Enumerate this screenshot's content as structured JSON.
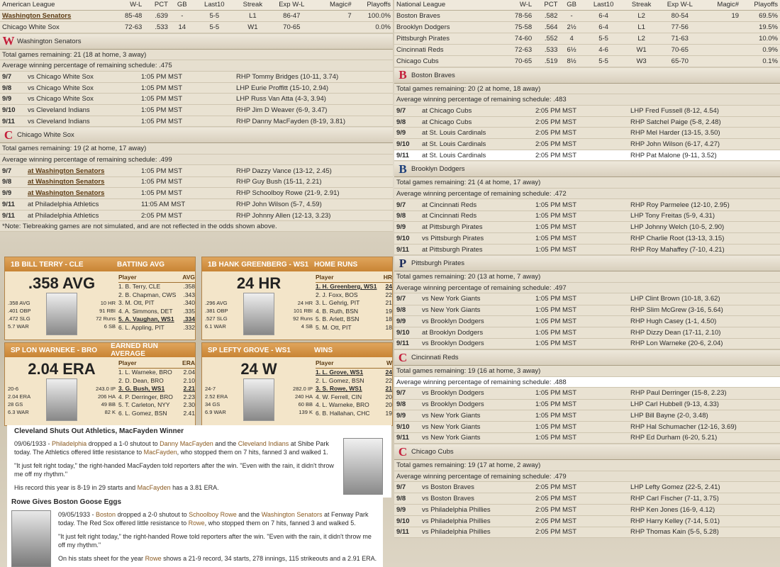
{
  "al": {
    "headers": [
      "American League",
      "W-L",
      "PCT",
      "GB",
      "Last10",
      "Streak",
      "Exp W-L",
      "Magic#",
      "Playoffs"
    ],
    "rows": [
      [
        "Washington Senators",
        "85-48",
        ".639",
        "-",
        "5-5",
        "L1",
        "86-47",
        "7",
        "100.0%"
      ],
      [
        "Chicago White Sox",
        "72-63",
        ".533",
        "14",
        "5-5",
        "W1",
        "70-65",
        "",
        "0.0%"
      ]
    ],
    "teams": [
      {
        "name": "Washington Senators",
        "logo": "W",
        "color": "#c41e3a",
        "rem": "Total games remaining: 21 (18 at home, 3 away)",
        "avg": "Average winning percentage of remaining schedule: .475",
        "games": [
          [
            "9/7",
            "vs Chicago White Sox",
            "1:05 PM MST",
            "RHP Tommy Bridges (10-11, 3.74)"
          ],
          [
            "9/8",
            "vs Chicago White Sox",
            "1:05 PM MST",
            "LHP Eurie Proffitt (15-10, 2.94)"
          ],
          [
            "9/9",
            "vs Chicago White Sox",
            "1:05 PM MST",
            "LHP Russ Van Atta (4-3, 3.94)"
          ],
          [
            "9/10",
            "vs Cleveland Indians",
            "1:05 PM MST",
            "RHP Jim D Weaver (6-9, 3.47)"
          ],
          [
            "9/11",
            "vs Cleveland Indians",
            "1:05 PM MST",
            "RHP Danny MacFayden (8-19, 3.81)"
          ]
        ]
      },
      {
        "name": "Chicago White Sox",
        "logo": "C",
        "color": "#c41e3a",
        "rem": "Total games remaining: 19 (2 at home, 17 away)",
        "avg": "Average winning percentage of remaining schedule: .499",
        "games": [
          [
            "9/7",
            "at Washington Senators",
            "1:05 PM MST",
            "RHP Dazzy Vance (13-12, 2.45)"
          ],
          [
            "9/8",
            "at Washington Senators",
            "1:05 PM MST",
            "RHP Guy Bush (15-11, 2.21)"
          ],
          [
            "9/9",
            "at Washington Senators",
            "1:05 PM MST",
            "RHP Schoolboy Rowe (21-9, 2.91)"
          ],
          [
            "9/11",
            "at Philadelphia Athletics",
            "11:05 AM MST",
            "RHP John Wilson (5-7, 4.59)"
          ],
          [
            "9/11",
            "at Philadelphia Athletics",
            "2:05 PM MST",
            "RHP Johnny Allen (12-13, 3.23)"
          ]
        ]
      }
    ],
    "note": "*Note: Tiebreaking games are not simulated, and are not reflected in the odds shown above."
  },
  "nl": {
    "headers": [
      "National League",
      "W-L",
      "PCT",
      "GB",
      "Last10",
      "Streak",
      "Exp W-L",
      "Magic#",
      "Playoffs"
    ],
    "rows": [
      [
        "Boston Braves",
        "78-56",
        ".582",
        "-",
        "6-4",
        "L2",
        "80-54",
        "19",
        "69.5%"
      ],
      [
        "Brooklyn Dodgers",
        "75-58",
        ".564",
        "2½",
        "6-4",
        "L1",
        "77-56",
        "",
        "19.5%"
      ],
      [
        "Pittsburgh Pirates",
        "74-60",
        ".552",
        "4",
        "5-5",
        "L2",
        "71-63",
        "",
        "10.0%"
      ],
      [
        "Cincinnati Reds",
        "72-63",
        ".533",
        "6½",
        "4-6",
        "W1",
        "70-65",
        "",
        "0.9%"
      ],
      [
        "Chicago Cubs",
        "70-65",
        ".519",
        "8½",
        "5-5",
        "W3",
        "65-70",
        "",
        "0.1%"
      ]
    ],
    "teams": [
      {
        "name": "Boston Braves",
        "logo": "B",
        "color": "#c41e3a",
        "rem": "Total games remaining: 20 (2 at home, 18 away)",
        "avg": "Average winning percentage of remaining schedule: .483",
        "games": [
          [
            "9/7",
            "at Chicago Cubs",
            "2:05 PM MST",
            "LHP Fred Fussell (8-12, 4.54)"
          ],
          [
            "9/8",
            "at Chicago Cubs",
            "2:05 PM MST",
            "RHP Satchel Paige (5-8, 2.48)"
          ],
          [
            "9/9",
            "at St. Louis Cardinals",
            "2:05 PM MST",
            "RHP Mel Harder (13-15, 3.50)"
          ],
          [
            "9/10",
            "at St. Louis Cardinals",
            "2:05 PM MST",
            "RHP John Wilson (6-17, 4.27)"
          ],
          [
            "9/11",
            "at St. Louis Cardinals",
            "2:05 PM MST",
            "RHP Pat Malone (9-11, 3.52)"
          ]
        ]
      },
      {
        "name": "Brooklyn Dodgers",
        "logo": "B",
        "color": "#1d3f7a",
        "rem": "Total games remaining: 21 (4 at home, 17 away)",
        "avg": "Average winning percentage of remaining schedule: .472",
        "games": [
          [
            "9/7",
            "at Cincinnati Reds",
            "1:05 PM MST",
            "RHP Roy Parmelee (12-10, 2.95)"
          ],
          [
            "9/8",
            "at Cincinnati Reds",
            "1:05 PM MST",
            "LHP Tony Freitas (5-9, 4.31)"
          ],
          [
            "9/9",
            "at Pittsburgh Pirates",
            "1:05 PM MST",
            "LHP Johnny Welch (10-5, 2.90)"
          ],
          [
            "9/10",
            "vs Pittsburgh Pirates",
            "1:05 PM MST",
            "RHP Charlie Root (13-13, 3.15)"
          ],
          [
            "9/11",
            "at Pittsburgh Pirates",
            "1:05 PM MST",
            "RHP Roy Mahaffey (7-10, 4.21)"
          ]
        ]
      },
      {
        "name": "Pittsburgh Pirates",
        "logo": "P",
        "color": "#1a2a5a",
        "rem": "Total games remaining: 20 (13 at home, 7 away)",
        "avg": "Average winning percentage of remaining schedule: .497",
        "games": [
          [
            "9/7",
            "vs New York Giants",
            "1:05 PM MST",
            "LHP Clint Brown (10-18, 3.62)"
          ],
          [
            "9/8",
            "vs New York Giants",
            "1:05 PM MST",
            "RHP Slim McGrew (3-16, 5.64)"
          ],
          [
            "9/9",
            "vs Brooklyn Dodgers",
            "1:05 PM MST",
            "RHP Hugh Casey (1-1, 4.50)"
          ],
          [
            "9/10",
            "at Brooklyn Dodgers",
            "1:05 PM MST",
            "RHP Dizzy Dean (17-11, 2.10)"
          ],
          [
            "9/11",
            "vs Brooklyn Dodgers",
            "1:05 PM MST",
            "RHP Lon Warneke (20-6, 2.04)"
          ]
        ]
      },
      {
        "name": "Cincinnati Reds",
        "logo": "C",
        "color": "#c41e3a",
        "rem": "Total games remaining: 19 (16 at home, 3 away)",
        "avg": "Average winning percentage of remaining schedule: .488",
        "games": [
          [
            "9/7",
            "vs Brooklyn Dodgers",
            "1:05 PM MST",
            "RHP Paul Derringer (15-8, 2.23)"
          ],
          [
            "9/8",
            "vs Brooklyn Dodgers",
            "1:05 PM MST",
            "LHP Carl Hubbell (9-13, 4.33)"
          ],
          [
            "9/9",
            "vs New York Giants",
            "1:05 PM MST",
            "LHP Bill Bayne (2-0, 3.48)"
          ],
          [
            "9/10",
            "vs New York Giants",
            "1:05 PM MST",
            "RHP Hal Schumacher (12-16, 3.69)"
          ],
          [
            "9/11",
            "vs New York Giants",
            "1:05 PM MST",
            "RHP Ed Durham (6-20, 5.21)"
          ]
        ]
      },
      {
        "name": "Chicago Cubs",
        "logo": "C",
        "color": "#c41e3a",
        "rem": "Total games remaining: 19 (17 at home, 2 away)",
        "avg": "Average winning percentage of remaining schedule: .479",
        "games": [
          [
            "9/7",
            "vs Boston Braves",
            "2:05 PM MST",
            "LHP Lefty Gomez (22-5, 2.41)"
          ],
          [
            "9/8",
            "vs Boston Braves",
            "2:05 PM MST",
            "RHP Carl Fischer (7-11, 3.75)"
          ],
          [
            "9/9",
            "vs Philadelphia Phillies",
            "2:05 PM MST",
            "RHP Ken Jones (16-9, 4.12)"
          ],
          [
            "9/10",
            "vs Philadelphia Phillies",
            "2:05 PM MST",
            "RHP Harry Kelley (7-14, 5.01)"
          ],
          [
            "9/11",
            "vs Philadelphia Phillies",
            "2:05 PM MST",
            "RHP Thomas Kain (5-5, 5.28)"
          ]
        ]
      }
    ]
  },
  "leaders": [
    {
      "title": "1B BILL TERRY - CLE",
      "stat": "BATTING AVG",
      "big": ".358 AVG",
      "left": [
        ".358 AVG",
        ".401 OBP",
        ".472 SLG",
        "5.7 WAR"
      ],
      "right": [
        "10 HR",
        "91 RBI",
        "72 Runs",
        "6 SB"
      ],
      "colname": "AVG",
      "rows": [
        [
          "1. B. Terry, CLE",
          ".358"
        ],
        [
          "2. B. Chapman, CWS",
          ".343"
        ],
        [
          "3. M. Ott, PIT",
          ".340"
        ],
        [
          "4. A. Simmons, DET",
          ".335"
        ],
        [
          "5. A. Vaughan, WS1",
          ".334"
        ],
        [
          "6. L. Appling, PIT",
          ".332"
        ]
      ],
      "sel": 4
    },
    {
      "title": "1B HANK GREENBERG - WS1",
      "stat": "HOME RUNS",
      "big": "24 HR",
      "left": [
        ".296 AVG",
        ".381 OBP",
        ".527 SLG",
        "6.1 WAR"
      ],
      "right": [
        "24 HR",
        "101 RBI",
        "92 Runs",
        "4 SB"
      ],
      "colname": "HR",
      "rows": [
        [
          "1. H. Greenberg, WS1",
          "24"
        ],
        [
          "2. J. Foxx, BOS",
          "22"
        ],
        [
          "3. L. Gehrig, PIT",
          "21"
        ],
        [
          "4. B. Ruth, BSN",
          "19"
        ],
        [
          "5. B. Arlett, BSN",
          "18"
        ],
        [
          "5. M. Ott, PIT",
          "18"
        ]
      ],
      "sel": 0
    },
    {
      "title": "SP LON WARNEKE - BRO",
      "stat": "EARNED RUN AVERAGE",
      "big": "2.04 ERA",
      "left": [
        "20-6",
        "2.04 ERA",
        "28 GS",
        "6.3 WAR"
      ],
      "right": [
        "243.0 IP",
        "206 HA",
        "49 BB",
        "82 K"
      ],
      "colname": "ERA",
      "rows": [
        [
          "1. L. Warneke, BRO",
          "2.04"
        ],
        [
          "2. D. Dean, BRO",
          "2.10"
        ],
        [
          "3. G. Bush, WS1",
          "2.21"
        ],
        [
          "4. P. Derringer, BRO",
          "2.23"
        ],
        [
          "5. T. Carleton, NYY",
          "2.30"
        ],
        [
          "6. L. Gomez, BSN",
          "2.41"
        ]
      ],
      "sel": 2
    },
    {
      "title": "SP LEFTY GROVE - WS1",
      "stat": "WINS",
      "big": "24 W",
      "left": [
        "24-7",
        "2.52 ERA",
        "34 GS",
        "6.9 WAR"
      ],
      "right": [
        "282.0 IP",
        "240 HA",
        "60 BB",
        "139 K"
      ],
      "colname": "W",
      "rows": [
        [
          "1. L. Grove, WS1",
          "24"
        ],
        [
          "2. L. Gomez, BSN",
          "22"
        ],
        [
          "3. S. Rowe, WS1",
          "21"
        ],
        [
          "4. W. Ferrell, CIN",
          "20"
        ],
        [
          "4. L. Warneke, BRO",
          "20"
        ],
        [
          "6. B. Hallahan, CHC",
          "19"
        ]
      ],
      "sel": [
        0,
        2
      ]
    }
  ],
  "news": [
    {
      "headline": "Cleveland Shuts Out Athletics, MacFayden Winner",
      "p1a": "09/06/1933 - ",
      "p1b": "Philadelphia",
      "p1c": " dropped a 1-0 shutout to ",
      "p1d": "Danny MacFayden",
      "p1e": " and the ",
      "p1f": "Cleveland Indians",
      "p1g": " at Shibe Park today. The Athletics offered little resistance to ",
      "p1h": "MacFayden",
      "p1i": ", who stopped them on 7 hits, fanned 3 and walked 1.",
      "p2": "\"It just felt right today,\" the right-handed MacFayden told reporters after the win. \"Even with the rain, it didn't throw me off my rhythm.\"",
      "p3a": "His record this year is 8-19 in 29 starts and ",
      "p3b": "MacFayden",
      "p3c": " has a 3.81 ERA."
    },
    {
      "headline": "Rowe Gives Boston Goose Eggs",
      "p1a": "09/05/1933 - ",
      "p1b": "Boston",
      "p1c": " dropped a 2-0 shutout to ",
      "p1d": "Schoolboy Rowe",
      "p1e": " and the ",
      "p1f": "Washington Senators",
      "p1g": " at Fenway Park today. The Red Sox offered little resistance to ",
      "p1h": "Rowe",
      "p1i": ", who stopped them on 7 hits, fanned 3 and walked 5.",
      "p2": "\"It just felt right today,\" the right-handed Rowe told reporters after the win. \"Even with the rain, it didn't throw me off my rhythm.\"",
      "p3a": "On his stats sheet for the year ",
      "p3b": "Rowe",
      "p3c": " shows a 21-9 record, 34 starts, 278 innings, 115 strikeouts and a 2.91 ERA."
    }
  ]
}
